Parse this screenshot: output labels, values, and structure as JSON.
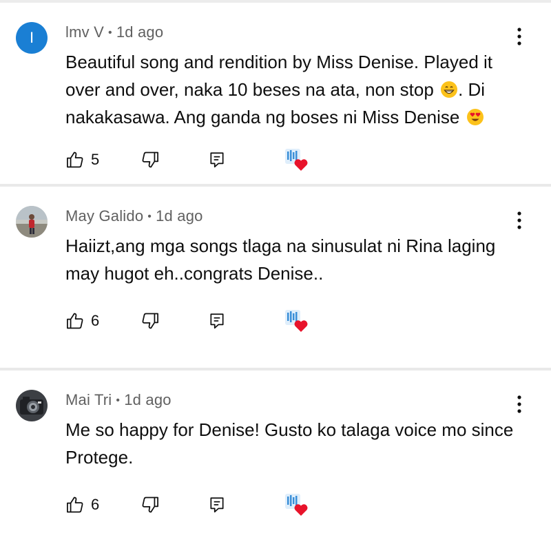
{
  "comments": [
    {
      "avatar_letter": "I",
      "author": "lmv V",
      "time": "1d ago",
      "text_parts": [
        "Beautiful song and rendition by Miss Denise. Played it over and over, naka 10 beses na ata, non stop",
        ". Di nakakasawa. Ang ganda ng boses ni Miss Denise"
      ],
      "emojis": [
        "grinning-face-emoji",
        "heart-eyes-emoji"
      ],
      "likes": "5"
    },
    {
      "author": "May Galido",
      "time": "1d ago",
      "text": "Haiizt,ang mga songs tlaga na sinusulat ni Rina laging may hugot eh..congrats Denise..",
      "likes": "6"
    },
    {
      "author": "Mai Tri",
      "time": "1d ago",
      "text": "Me so happy for Denise! Gusto ko talaga voice mo since Protege.",
      "likes": "6"
    }
  ],
  "meta_separator": "•",
  "colors": {
    "avatar_blue": "#1a7fd4",
    "meta_gray": "#606060",
    "heart_red": "#e8132b",
    "creator_blue": "#3a8fd8"
  },
  "icons": [
    "thumbs-up-icon",
    "thumbs-down-icon",
    "reply-icon",
    "creator-heart-icon",
    "more-vert-icon"
  ]
}
